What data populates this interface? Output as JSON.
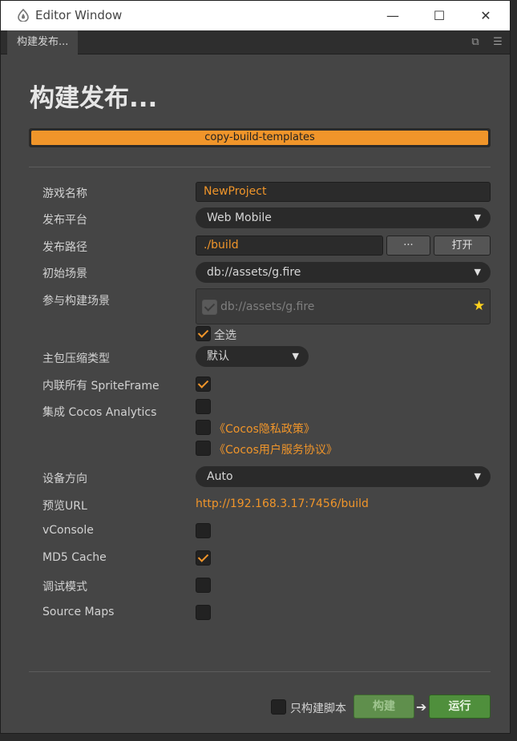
{
  "window": {
    "title": "Editor Window",
    "controls": {
      "minimize": "—",
      "maximize": "☐",
      "close": "✕"
    }
  },
  "tab": {
    "label": "构建发布..."
  },
  "page": {
    "title": "构建发布..."
  },
  "progress": {
    "text": "copy-build-templates",
    "fraction": 1.0,
    "color": "#f0952a"
  },
  "form": {
    "game_name": {
      "label": "游戏名称",
      "value": "NewProject"
    },
    "platform": {
      "label": "发布平台",
      "value": "Web Mobile"
    },
    "build_path": {
      "label": "发布路径",
      "value": "./build",
      "browse_label": "···",
      "open_label": "打开"
    },
    "start_scene": {
      "label": "初始场景",
      "value": "db://assets/g.fire"
    },
    "included_scenes": {
      "label": "参与构建场景",
      "items": [
        {
          "path": "db://assets/g.fire",
          "checked": true
        }
      ],
      "select_all_label": "全选"
    },
    "compression": {
      "label": "主包压缩类型",
      "value": "默认"
    },
    "inline_spriteframes": {
      "label": "内联所有 SpriteFrame",
      "checked": true
    },
    "cocos_analytics": {
      "label": "集成 Cocos Analytics",
      "checked": false,
      "privacy_link": "《Cocos隐私政策》",
      "terms_link": "《Cocos用户服务协议》"
    },
    "orientation": {
      "label": "设备方向",
      "value": "Auto"
    },
    "preview_url": {
      "label": "预览URL",
      "value": "http://192.168.3.17:7456/build"
    },
    "vconsole": {
      "label": "vConsole",
      "checked": false
    },
    "md5_cache": {
      "label": "MD5 Cache",
      "checked": true
    },
    "debug_mode": {
      "label": "调试模式",
      "checked": false
    },
    "source_maps": {
      "label": "Source Maps",
      "checked": false
    }
  },
  "footer": {
    "script_only_label": "只构建脚本",
    "build_label": "构建",
    "run_label": "运行"
  },
  "colors": {
    "accent": "#f0952a",
    "panel": "#454545",
    "build_button": "#5f8f4c",
    "run_button": "#4f8f3c"
  }
}
